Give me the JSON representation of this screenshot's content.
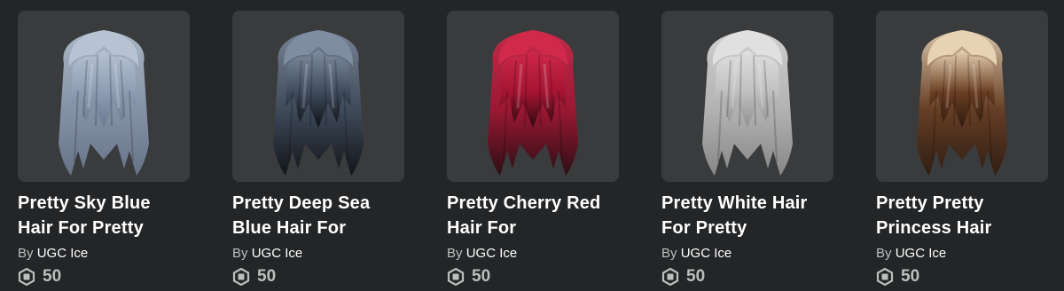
{
  "items": [
    {
      "name": "Pretty Sky Blue Hair For Pretty",
      "by": "By",
      "creator": "UGC Ice",
      "price": "50",
      "icon": "robux-icon",
      "hair_colors": {
        "top": "#b7c3d3",
        "mid": "#8d9cb2",
        "tip": "#6b7890"
      }
    },
    {
      "name": "Pretty Deep Sea Blue Hair For",
      "by": "By",
      "creator": "UGC Ice",
      "price": "50",
      "icon": "robux-icon",
      "hair_colors": {
        "top": "#7f8da0",
        "mid": "#3f4b5c",
        "tip": "#0e1116"
      }
    },
    {
      "name": "Pretty Cherry Red Hair For",
      "by": "By",
      "creator": "UGC Ice",
      "price": "50",
      "icon": "robux-icon",
      "hair_colors": {
        "top": "#d0294a",
        "mid": "#a51432",
        "tip": "#2a0a10"
      }
    },
    {
      "name": "Pretty White Hair For Pretty",
      "by": "By",
      "creator": "UGC Ice",
      "price": "50",
      "icon": "robux-icon",
      "hair_colors": {
        "top": "#e0e0e0",
        "mid": "#bfbfbf",
        "tip": "#8f8f8f"
      }
    },
    {
      "name": "Pretty Pretty Princess Hair",
      "by": "By",
      "creator": "UGC Ice",
      "price": "50",
      "icon": "robux-icon",
      "hair_colors": {
        "top": "#e8d2b4",
        "mid": "#6a3e22",
        "tip": "#2e1a0e"
      }
    }
  ]
}
